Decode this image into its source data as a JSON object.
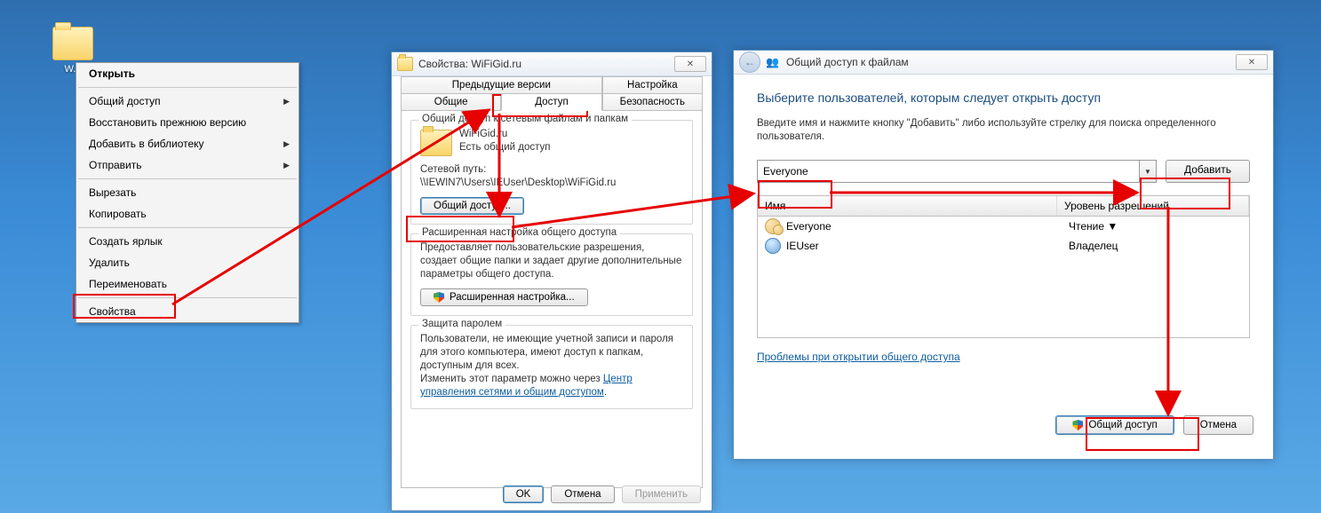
{
  "desktop": {
    "folder_label": "W..."
  },
  "ctxmenu": {
    "open": "Открыть",
    "share": "Общий доступ",
    "restore": "Восстановить прежнюю версию",
    "addlib": "Добавить в библиотеку",
    "sendto": "Отправить",
    "cut": "Вырезать",
    "copy": "Копировать",
    "shortcut": "Создать ярлык",
    "delete": "Удалить",
    "rename": "Переименовать",
    "properties": "Свойства"
  },
  "prop": {
    "title": "Свойства: WiFiGid.ru",
    "tabs": {
      "prev": "Предыдущие версии",
      "cfg": "Настройка",
      "general": "Общие",
      "access": "Доступ",
      "security": "Безопасность"
    },
    "grp1_title": "Общий доступ к сетевым файлам и папкам",
    "folder_name": "WiFiGid.ru",
    "shared_state": "Есть общий доступ",
    "netpath_label": "Сетевой путь:",
    "netpath": "\\\\IEWIN7\\Users\\IEUser\\Desktop\\WiFiGid.ru",
    "share_btn": "Общий доступ...",
    "grp2_title": "Расширенная настройка общего доступа",
    "grp2_desc": "Предоставляет пользовательские разрешения, создает общие папки и задает другие дополнительные параметры общего доступа.",
    "adv_btn": "Расширенная настройка...",
    "grp3_title": "Защита паролем",
    "grp3_desc": "Пользователи, не имеющие учетной записи и пароля для этого компьютера, имеют доступ к папкам, доступным для всех.",
    "grp3_desc2_a": "Изменить этот параметр можно через ",
    "grp3_link": "Центр управления сетями и общим доступом",
    "ok": "OK",
    "cancel": "Отмена",
    "apply": "Применить"
  },
  "share": {
    "titlebar": "Общий доступ к файлам",
    "heading": "Выберите пользователей, которым следует открыть доступ",
    "desc": "Введите имя и нажмите кнопку \"Добавить\" либо используйте стрелку для поиска определенного пользователя.",
    "combo_value": "Everyone",
    "add_btn": "Добавить",
    "col_name": "Имя",
    "col_perm": "Уровень разрешений",
    "rows": [
      {
        "name": "Everyone",
        "perm": "Чтение ▼"
      },
      {
        "name": "IEUser",
        "perm": "Владелец"
      }
    ],
    "trouble": "Проблемы при открытии общего доступа",
    "share_btn": "Общий доступ",
    "cancel": "Отмена"
  }
}
